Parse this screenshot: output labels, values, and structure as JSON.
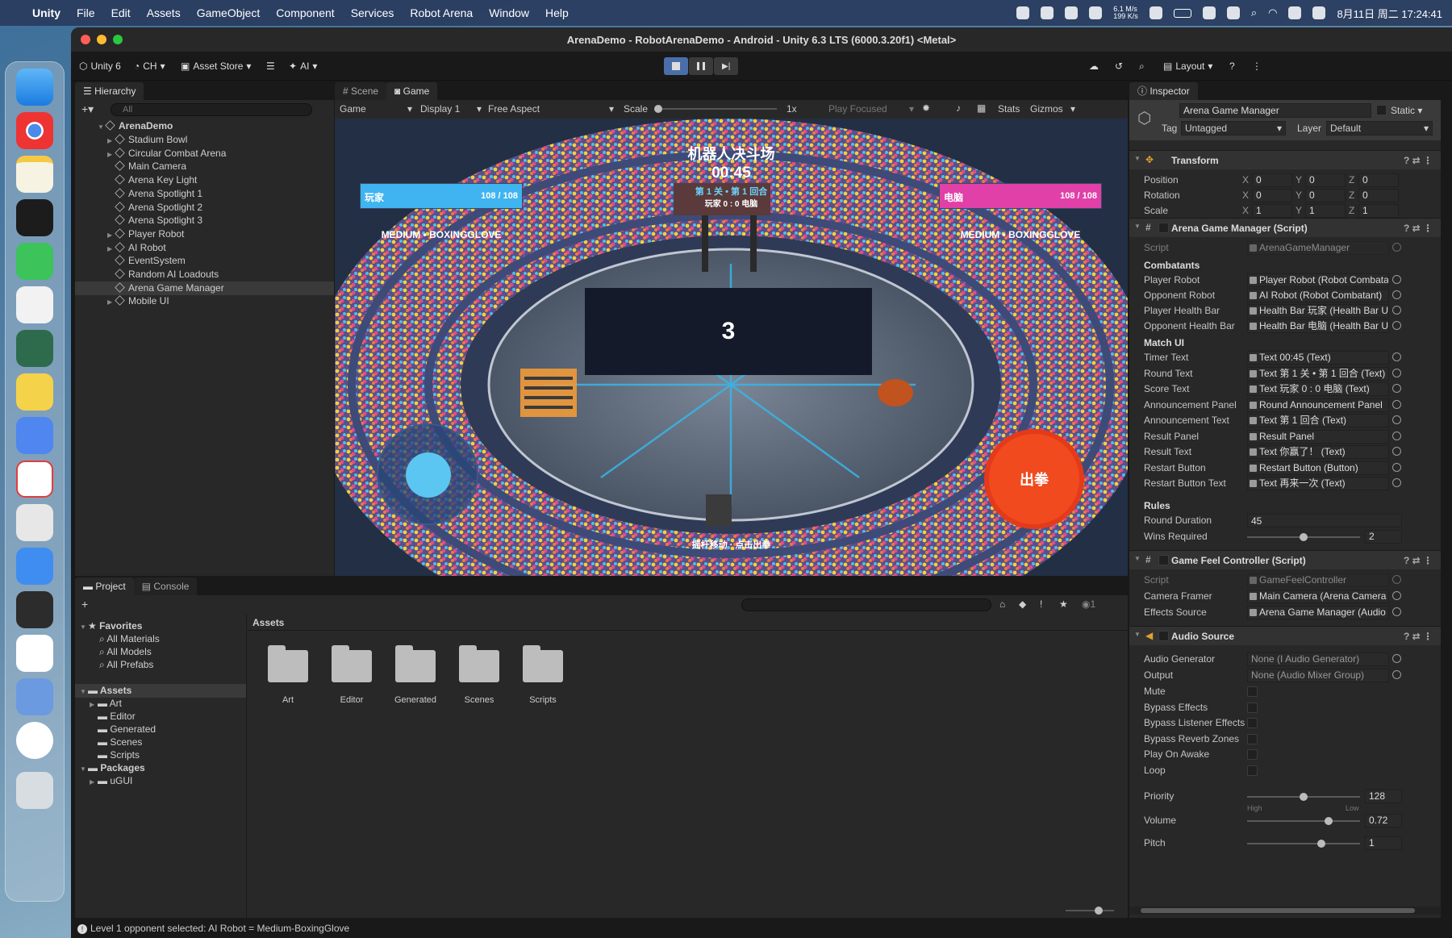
{
  "menubar": {
    "app": "Unity",
    "items": [
      "File",
      "Edit",
      "Assets",
      "GameObject",
      "Component",
      "Services",
      "Robot Arena",
      "Window",
      "Help"
    ],
    "net_up": "6.1 M/s",
    "net_down": "199 K/s",
    "datetime": "8月11日 周二  17:24:41"
  },
  "window": {
    "title": "ArenaDemo - RobotArenaDemo - Android - Unity 6.3 LTS (6000.3.20f1) <Metal>"
  },
  "toolbar": {
    "unity": "Unity 6",
    "account": "CH",
    "asset_store": "Asset Store",
    "ai": "AI",
    "layout": "Layout"
  },
  "hierarchy": {
    "tab": "Hierarchy",
    "search": "All",
    "scene": "ArenaDemo",
    "items": [
      "Stadium Bowl",
      "Circular Combat Arena",
      "Main Camera",
      "Arena Key Light",
      "Arena Spotlight 1",
      "Arena Spotlight 2",
      "Arena Spotlight 3",
      "Player Robot",
      "AI Robot",
      "EventSystem",
      "Random AI Loadouts",
      "Arena Game Manager",
      "Mobile UI"
    ],
    "selected": "Arena Game Manager"
  },
  "gameview": {
    "tabs": [
      "Scene",
      "Game"
    ],
    "active_tab": "Game",
    "mode": "Game",
    "display": "Display 1",
    "aspect": "Free Aspect",
    "scale_label": "Scale",
    "scale": "1x",
    "play_focused": "Play Focused",
    "stats": "Stats",
    "gizmos": "Gizmos"
  },
  "hud": {
    "title": "机器人决斗场",
    "timer": "00:45",
    "round": "第 1 关 • 第 1 回合",
    "score": "玩家 0 : 0 电脑",
    "player_name": "玩家",
    "player_hp": "108 / 108",
    "player_hp_pct": 1.0,
    "enemy_name": "电脑",
    "enemy_hp": "108 / 108",
    "enemy_hp_pct": 1.0,
    "player_loadout": "MEDIUM • BOXINGGLOVE",
    "enemy_loadout": "MEDIUM • BOXINGGLOVE",
    "countdown": "3",
    "punch": "出拳",
    "hint": "摇杆移动 · 点击出拳",
    "player_color": "#3fb4f0",
    "enemy_color": "#e040a8",
    "punch_color": "#f04a1e"
  },
  "project": {
    "tabs": [
      "Project",
      "Console"
    ],
    "favorites": "Favorites",
    "fav_items": [
      "All Materials",
      "All Models",
      "All Prefabs"
    ],
    "assets": "Assets",
    "asset_items": [
      "Art",
      "Editor",
      "Generated",
      "Scenes",
      "Scripts"
    ],
    "packages": "Packages",
    "package_items": [
      "uGUI"
    ],
    "breadcrumb": "Assets",
    "folders": [
      "Art",
      "Editor",
      "Generated",
      "Scenes",
      "Scripts"
    ],
    "hidden_count": "1"
  },
  "status": {
    "text": "Level 1 opponent selected: AI Robot = Medium-BoxingGlove"
  },
  "inspector": {
    "tab": "Inspector",
    "object_name": "Arena Game Manager",
    "static": "Static",
    "tag_label": "Tag",
    "tag": "Untagged",
    "layer_label": "Layer",
    "layer": "Default",
    "transform": {
      "title": "Transform",
      "rows": [
        {
          "label": "Position",
          "x": "0",
          "y": "0",
          "z": "0"
        },
        {
          "label": "Rotation",
          "x": "0",
          "y": "0",
          "z": "0"
        },
        {
          "label": "Scale",
          "x": "1",
          "y": "1",
          "z": "1"
        }
      ]
    },
    "manager": {
      "title": "Arena Game Manager (Script)",
      "script_label": "Script",
      "script": "ArenaGameManager",
      "combatants": "Combatants",
      "combatant_rows": [
        {
          "label": "Player Robot",
          "value": "Player Robot (Robot Combatant)"
        },
        {
          "label": "Opponent Robot",
          "value": "AI Robot (Robot Combatant)"
        },
        {
          "label": "Player Health Bar",
          "value": "Health Bar 玩家 (Health Bar UI)"
        },
        {
          "label": "Opponent Health Bar",
          "value": "Health Bar 电脑 (Health Bar UI)"
        }
      ],
      "match_ui": "Match UI",
      "match_rows": [
        {
          "label": "Timer Text",
          "value": "Text 00:45 (Text)"
        },
        {
          "label": "Round Text",
          "value": "Text 第 1 关 • 第 1 回合 (Text)"
        },
        {
          "label": "Score Text",
          "value": "Text 玩家 0 : 0 电脑 (Text)"
        },
        {
          "label": "Announcement Panel",
          "value": "Round Announcement Panel"
        },
        {
          "label": "Announcement Text",
          "value": "Text 第 1 回合 (Text)"
        },
        {
          "label": "Result Panel",
          "value": "Result Panel"
        },
        {
          "label": "Result Text",
          "value": "Text 你赢了！ (Text)"
        },
        {
          "label": "Restart Button",
          "value": "Restart Button (Button)"
        },
        {
          "label": "Restart Button Text",
          "value": "Text 再来一次 (Text)"
        }
      ],
      "rules": "Rules",
      "round_duration_label": "Round Duration",
      "round_duration": "45",
      "wins_label": "Wins Required",
      "wins": "2",
      "wins_fraction": 0.5
    },
    "feel": {
      "title": "Game Feel Controller (Script)",
      "script_label": "Script",
      "script": "GameFeelController",
      "rows": [
        {
          "label": "Camera Framer",
          "value": "Main Camera (Arena Camera Framer)"
        },
        {
          "label": "Effects Source",
          "value": "Arena Game Manager (Audio Source)"
        }
      ]
    },
    "audio": {
      "title": "Audio Source",
      "generator_label": "Audio Generator",
      "generator": "None (I Audio Generator)",
      "output_label": "Output",
      "output": "None (Audio Mixer Group)",
      "checks": [
        "Mute",
        "Bypass Effects",
        "Bypass Listener Effects",
        "Bypass Reverb Zones",
        "Play On Awake",
        "Loop"
      ],
      "priority_label": "Priority",
      "priority": "128",
      "priority_fraction": 0.5,
      "high": "High",
      "low": "Low",
      "volume_label": "Volume",
      "volume": "0.72",
      "volume_fraction": 0.72,
      "pitch_label": "Pitch",
      "pitch": "1",
      "pitch_fraction": 0.66
    }
  }
}
